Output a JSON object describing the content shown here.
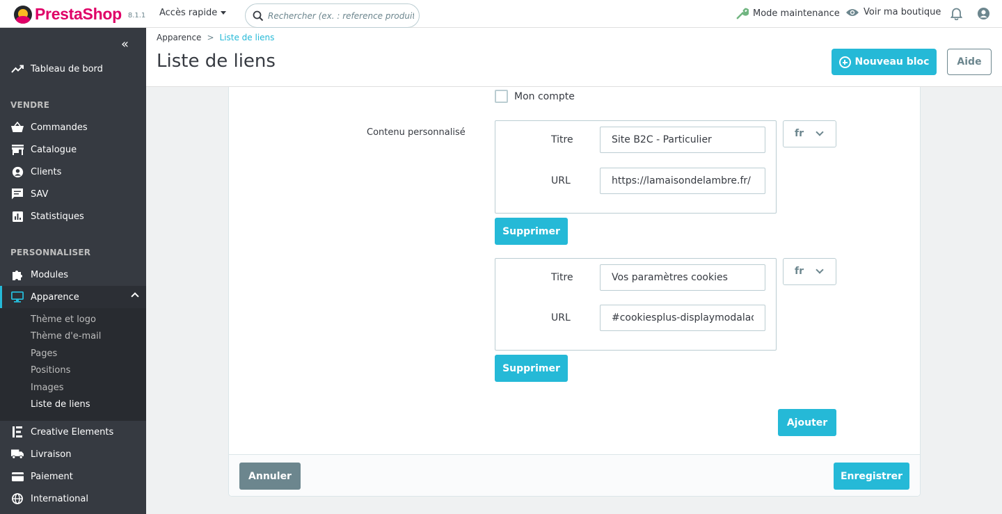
{
  "header": {
    "brand": "PrestaShop",
    "version": "8.1.1",
    "quick_access": "Accès rapide",
    "search_placeholder": "Rechercher (ex. : reference produit, no",
    "maintenance": "Mode maintenance",
    "view_shop": "Voir ma boutique"
  },
  "sidebar": {
    "dashboard": "Tableau de bord",
    "section_sell": "VENDRE",
    "orders": "Commandes",
    "catalog": "Catalogue",
    "customers": "Clients",
    "sav": "SAV",
    "stats": "Statistiques",
    "section_customize": "PERSONNALISER",
    "modules": "Modules",
    "appearance": "Apparence",
    "sub": [
      "Thème et logo",
      "Thème d'e-mail",
      "Pages",
      "Positions",
      "Images",
      "Liste de liens"
    ],
    "creative": "Creative Elements",
    "shipping": "Livraison",
    "payment": "Paiement",
    "international": "International"
  },
  "page": {
    "breadcrumb_parent": "Apparence",
    "breadcrumb_sep": ">",
    "breadcrumb_current": "Liste de liens",
    "title": "Liste de liens",
    "new_block": "Nouveau bloc",
    "help": "Aide"
  },
  "form": {
    "my_account": "Mon compte",
    "custom_content_label": "Contenu personnalisé",
    "links": [
      {
        "title_label": "Titre",
        "title_value": "Site B2C - Particulier",
        "url_label": "URL",
        "url_value": "https://lamaisondelambre.fr/",
        "lang": "fr",
        "delete": "Supprimer"
      },
      {
        "title_label": "Titre",
        "title_value": "Vos paramètres cookies",
        "url_label": "URL",
        "url_value": "#cookiesplus-displaymodaladva",
        "lang": "fr",
        "delete": "Supprimer"
      }
    ],
    "add": "Ajouter",
    "cancel": "Annuler",
    "save": "Enregistrer"
  },
  "colors": {
    "accent": "#25b9d7",
    "brand": "#df0067",
    "sidebar": "#363a41"
  }
}
